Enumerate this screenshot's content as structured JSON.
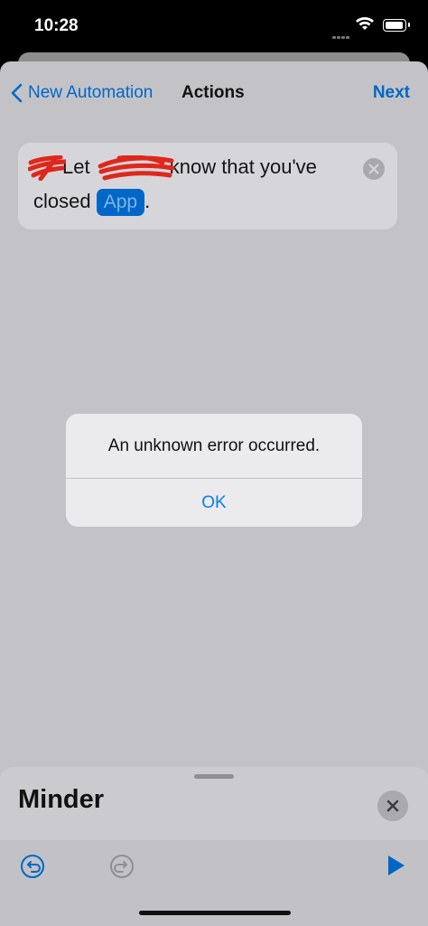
{
  "status_bar": {
    "time": "10:28"
  },
  "nav": {
    "back_label": "New Automation",
    "title": "Actions",
    "next_label": "Next"
  },
  "action_card": {
    "word_let": "Let",
    "text_main": "know that you've",
    "text_closed": "closed",
    "app_token": "App",
    "period": "."
  },
  "alert": {
    "message": "An unknown error occurred.",
    "ok_label": "OK"
  },
  "bottom_panel": {
    "title": "Minder"
  },
  "colors": {
    "accent": "#0067c7",
    "redaction": "#e0271c"
  }
}
